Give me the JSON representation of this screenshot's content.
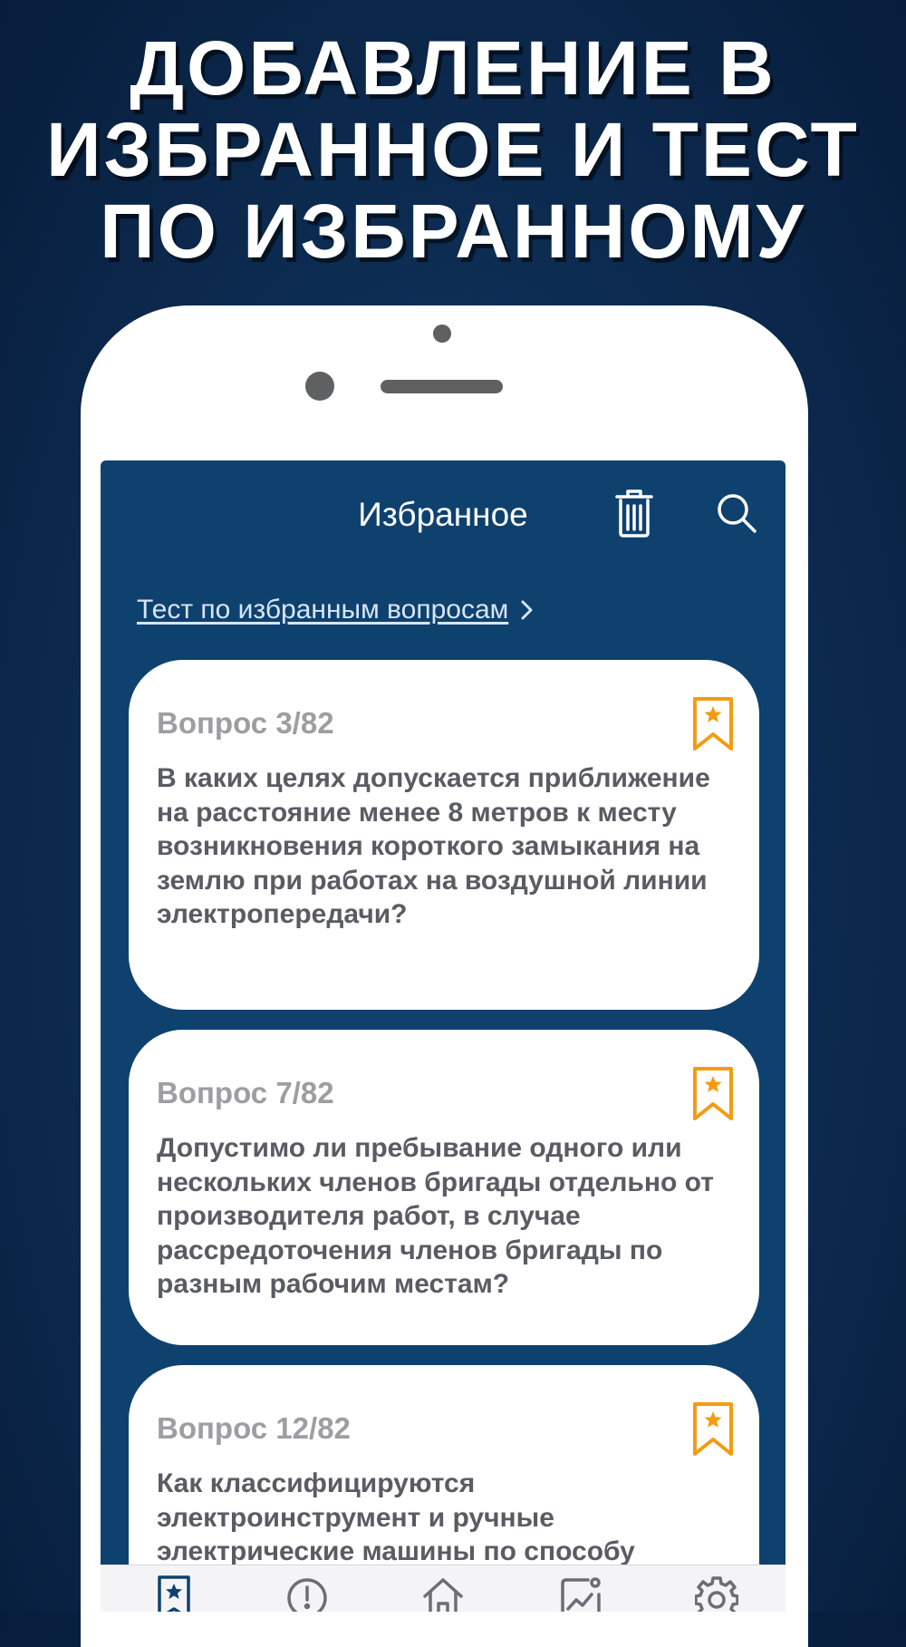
{
  "promo": {
    "headline_lines": [
      "ДОБАВЛЕНИЕ В",
      "ИЗБРАННОЕ И ТЕСТ",
      "ПО ИЗБРАННОМУ"
    ]
  },
  "header": {
    "title": "Избранное",
    "actions": [
      {
        "icon": "trash-icon"
      },
      {
        "icon": "search-icon"
      }
    ]
  },
  "test_link": {
    "label": "Тест по избранным вопросам",
    "icon": "chevron-right-icon"
  },
  "questions": [
    {
      "number": "Вопрос 3/82",
      "text": "В каких целях допускается приближение на расстояние менее 8 метров к месту возникновения короткого замыкания на землю при работах на воздушной линии электропередачи?",
      "bookmarked": true
    },
    {
      "number": "Вопрос 7/82",
      "text": "Допустимо ли пребывание одного или нескольких членов бригады отдельно от производителя работ, в случае рассредоточения членов бригады по разным рабочим местам?",
      "bookmarked": true
    },
    {
      "number": "Вопрос 12/82",
      "text": "Как классифицируются электроинструмент и ручные электрические машины по способу",
      "bookmarked": true
    }
  ],
  "bottom_nav": [
    {
      "icon": "favorites-icon",
      "active": true
    },
    {
      "icon": "exclamation-icon",
      "active": false
    },
    {
      "icon": "home-icon",
      "active": false
    },
    {
      "icon": "stats-icon",
      "active": false
    },
    {
      "icon": "gear-icon",
      "active": false
    }
  ],
  "colors": {
    "screen_bg": "#0f416f",
    "accent": "#f39c12",
    "card_bg": "#ffffff",
    "question_number": "#9e9ea2",
    "question_text": "#5b5b64"
  }
}
